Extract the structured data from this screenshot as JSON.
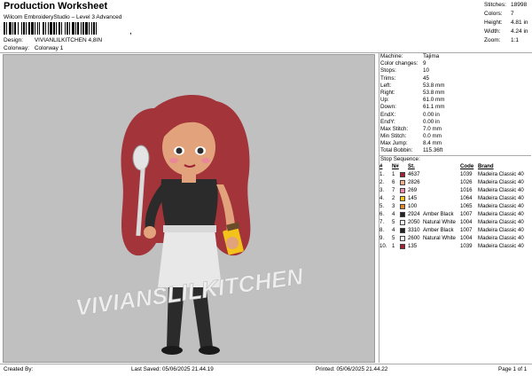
{
  "header": {
    "title": "Production Worksheet",
    "subtitle": "Wilcom EmbroideryStudio – Level 3 Advanced",
    "barcode_tail": ",",
    "design_label": "Design:",
    "design_value": "VIVIANLILKITCHEN 4,8IN",
    "colorway_label": "Colorway:",
    "colorway_value": "Colorway 1"
  },
  "stats": [
    {
      "k": "Stitches:",
      "v": "18998"
    },
    {
      "k": "Colors:",
      "v": "7"
    },
    {
      "k": "Height:",
      "v": "4.81 in"
    },
    {
      "k": "Width:",
      "v": "4.24 in"
    },
    {
      "k": "Zoom:",
      "v": "1:1"
    }
  ],
  "machine": [
    {
      "k": "Machine:",
      "v": "Tajima"
    },
    {
      "k": "Color changes:",
      "v": "9"
    },
    {
      "k": "Stops:",
      "v": "10"
    },
    {
      "k": "Trims:",
      "v": "45"
    },
    {
      "k": "Left:",
      "v": "53.8 mm"
    },
    {
      "k": "Right:",
      "v": "53.8 mm"
    },
    {
      "k": "Up:",
      "v": "61.0 mm"
    },
    {
      "k": "Down:",
      "v": "61.1 mm"
    },
    {
      "k": "EndX:",
      "v": "0.00 in"
    },
    {
      "k": "EndY:",
      "v": "0.00 in"
    },
    {
      "k": "Max Stitch:",
      "v": "7.0 mm"
    },
    {
      "k": "Min Stitch:",
      "v": "0.0 mm"
    },
    {
      "k": "Max Jump:",
      "v": "8.4 mm"
    },
    {
      "k": "Total Bobbin:",
      "v": "115.36ft"
    }
  ],
  "sequence": {
    "title": "Stop Sequence:",
    "headers": [
      "#",
      "N#",
      "",
      "St.",
      "",
      "Code",
      "Brand"
    ],
    "rows": [
      {
        "i": "1.",
        "n": "1",
        "color": "#9b2335",
        "st": "4637",
        "name": "",
        "code": "1039",
        "brand": "Madeira Classic 40"
      },
      {
        "i": "2.",
        "n": "6",
        "color": "#f0b08a",
        "st": "2826",
        "name": "",
        "code": "1026",
        "brand": "Madeira Classic 40"
      },
      {
        "i": "3.",
        "n": "7",
        "color": "#e98aa6",
        "st": "269",
        "name": "",
        "code": "1016",
        "brand": "Madeira Classic 40"
      },
      {
        "i": "4.",
        "n": "2",
        "color": "#f3c21b",
        "st": "145",
        "name": "",
        "code": "1064",
        "brand": "Madeira Classic 40"
      },
      {
        "i": "5.",
        "n": "3",
        "color": "#e0842a",
        "st": "100",
        "name": "",
        "code": "1065",
        "brand": "Madeira Classic 40"
      },
      {
        "i": "6.",
        "n": "4",
        "color": "#222222",
        "st": "2924",
        "name": "Amber Black",
        "code": "1007",
        "brand": "Madeira Classic 40"
      },
      {
        "i": "7.",
        "n": "5",
        "color": "#f7f7f7",
        "st": "2050",
        "name": "Natural White",
        "code": "1004",
        "brand": "Madeira Classic 40"
      },
      {
        "i": "8.",
        "n": "4",
        "color": "#222222",
        "st": "3310",
        "name": "Amber Black",
        "code": "1007",
        "brand": "Madeira Classic 40"
      },
      {
        "i": "9.",
        "n": "5",
        "color": "#f7f7f7",
        "st": "2600",
        "name": "Natural White",
        "code": "1004",
        "brand": "Madeira Classic 40"
      },
      {
        "i": "10.",
        "n": "1",
        "color": "#9b2335",
        "st": "135",
        "name": "",
        "code": "1039",
        "brand": "Madeira Classic 40"
      }
    ]
  },
  "artwork": {
    "text": "VIVIANSLILKITCHEN",
    "colors": {
      "hair": "#a3343a",
      "skin": "#e2a37c",
      "black": "#2b2b2b",
      "white": "#eeeeee",
      "canvas": "#c0c0c0"
    }
  },
  "footer": {
    "created_by": "Created By:",
    "last_saved": "Last Saved: 05/06/2025 21.44.19",
    "printed": "Printed: 05/06/2025 21.44.22",
    "page": "Page 1 of 1"
  }
}
